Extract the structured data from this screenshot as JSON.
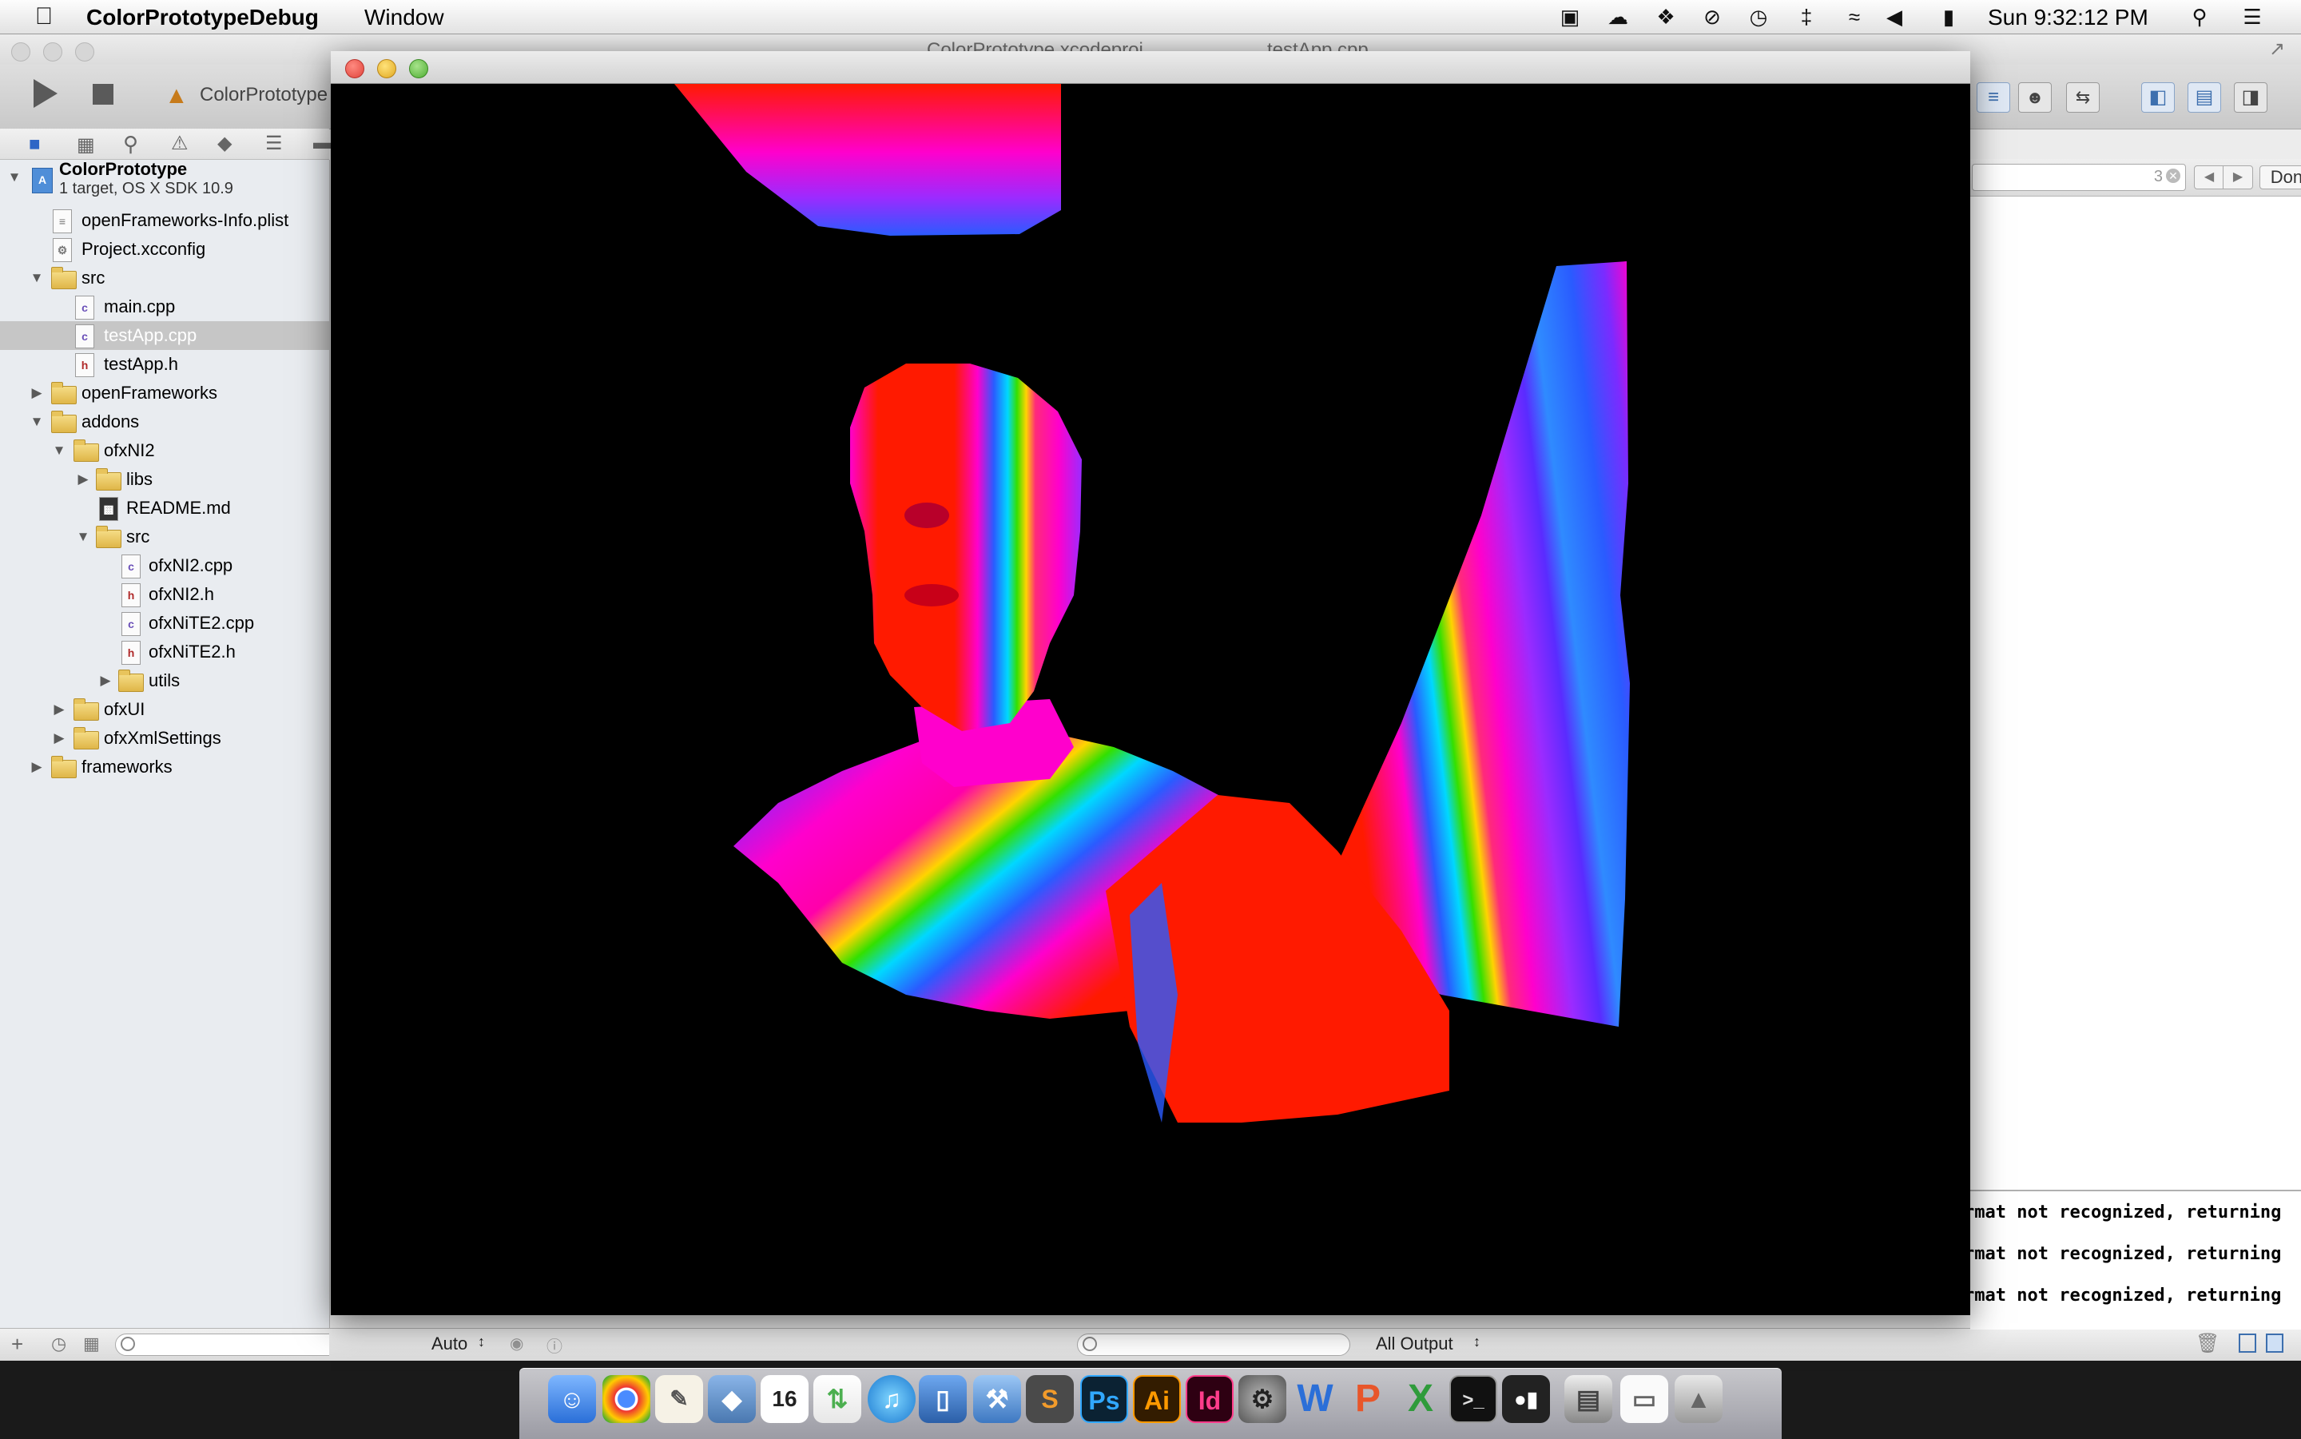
{
  "menubar": {
    "app_name": "ColorPrototypeDebug",
    "menu_window": "Window",
    "clock": "Sun 9:32:12 PM",
    "status_icons": [
      "screen-sharing-icon",
      "creative-cloud-icon",
      "dropbox-icon",
      "sync-icon",
      "time-machine-icon",
      "bluetooth-icon",
      "wifi-icon",
      "volume-icon",
      "battery-icon"
    ]
  },
  "xcode": {
    "tabs": [
      "ColorPrototype.xcodeproj",
      "testApp.cpp"
    ],
    "scheme": "ColorPrototype",
    "find": {
      "count": "3",
      "done_label": "Done"
    },
    "debug": {
      "auto_label": "Auto",
      "output_label": "All Output"
    },
    "console_lines": [
      "rmat not recognized, returning",
      "rmat not recognized, returning",
      "rmat not recognized, returning"
    ]
  },
  "navigator": {
    "project_name": "ColorPrototype",
    "project_subtitle": "1 target, OS X SDK 10.9",
    "items": [
      {
        "label": "openFrameworks-Info.plist"
      },
      {
        "label": "Project.xcconfig"
      },
      {
        "label": "src"
      },
      {
        "label": "main.cpp"
      },
      {
        "label": "testApp.cpp"
      },
      {
        "label": "testApp.h"
      },
      {
        "label": "openFrameworks"
      },
      {
        "label": "addons"
      },
      {
        "label": "ofxNI2"
      },
      {
        "label": "libs"
      },
      {
        "label": "README.md"
      },
      {
        "label": "src"
      },
      {
        "label": "ofxNI2.cpp"
      },
      {
        "label": "ofxNI2.h"
      },
      {
        "label": "ofxNiTE2.cpp"
      },
      {
        "label": "ofxNiTE2.h"
      },
      {
        "label": "utils"
      },
      {
        "label": "ofxUI"
      },
      {
        "label": "ofxXmlSettings"
      },
      {
        "label": "frameworks"
      }
    ]
  },
  "dock": {
    "items": [
      "finder-icon",
      "chrome-icon",
      "textedit-icon",
      "preview-icon",
      "calendar-icon",
      "transmit-icon",
      "itunes-icon",
      "keynote-icon",
      "xcode-icon",
      "sublime-icon",
      "photoshop-icon",
      "illustrator-icon",
      "indesign-icon",
      "system-preferences-icon",
      "word-icon",
      "powerpoint-icon",
      "excel-icon",
      "terminal-icon",
      "of-debug-app-icon",
      "utilities-folder-icon",
      "downloads-stack-icon",
      "trash-icon"
    ],
    "labels": {
      "calendar_day": "16",
      "photoshop": "Ps",
      "illustrator": "Ai",
      "indesign": "Id",
      "word": "W",
      "powerpoint": "P",
      "excel": "X",
      "terminal": ">_",
      "sublime": "S"
    }
  },
  "colors": {
    "depth_red": "#ff1a00",
    "depth_magenta": "#ff00cc",
    "depth_blue": "#2a7bff",
    "selection": "#c6c6c6"
  }
}
